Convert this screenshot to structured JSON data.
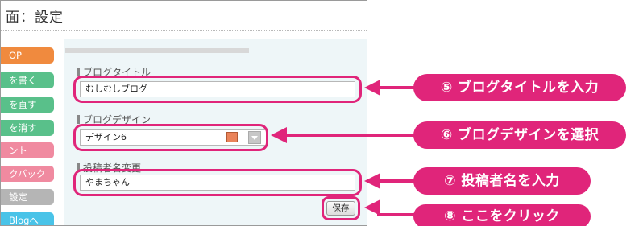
{
  "page": {
    "title": "面：設定"
  },
  "sidebar": {
    "items": [
      {
        "label": "OP",
        "color": "#f08a3e"
      },
      {
        "label": "を書く",
        "color": "#59c08a"
      },
      {
        "label": "を直す",
        "color": "#59c08a"
      },
      {
        "label": "を消す",
        "color": "#59c08a"
      },
      {
        "label": "ント",
        "color": "#f08aa0"
      },
      {
        "label": "クバック",
        "color": "#f08aa0"
      },
      {
        "label": "設定",
        "color": "#b5b5b5"
      },
      {
        "label": "Blogへ",
        "color": "#49c3e8"
      }
    ]
  },
  "form": {
    "blog_title": {
      "label": "ブログタイトル",
      "value": "むしむしブログ"
    },
    "blog_design": {
      "label": "ブログデザイン",
      "value": "デザイン6",
      "swatch_color": "#ea8359"
    },
    "author_name": {
      "label": "投稿者名変更",
      "value": "やまちゃん"
    },
    "save_label": "保存"
  },
  "callouts": [
    {
      "text": "⑤ ブログタイトルを入力"
    },
    {
      "text": "⑥ ブログデザインを選択"
    },
    {
      "text": "⑦ 投稿者名を入力"
    },
    {
      "text": "⑧ ここをクリック"
    }
  ],
  "accent_color": "#e0257a"
}
